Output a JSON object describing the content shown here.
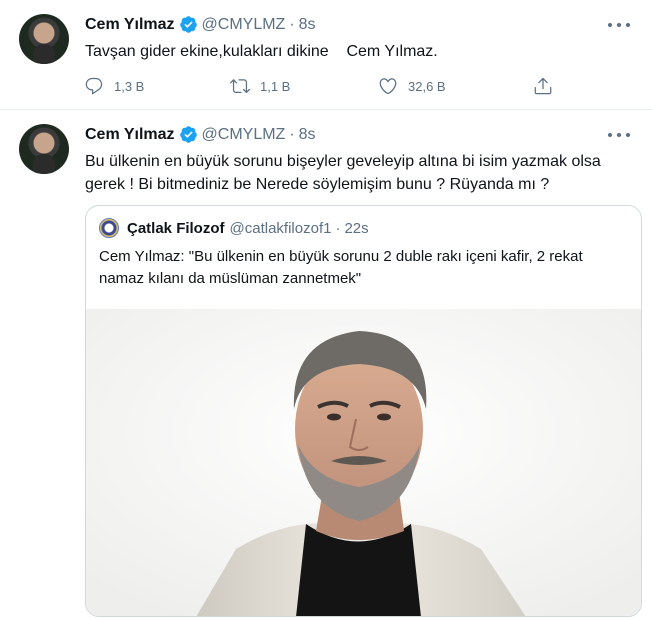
{
  "tweets": [
    {
      "author_name": "Cem Yılmaz",
      "handle": "@CMYLMZ",
      "separator": "·",
      "time": "8s",
      "text": "Tavşan gider ekine,kulakları dikine    Cem Yılmaz.",
      "stats": {
        "replies": "1,3 B",
        "retweets": "1,1 B",
        "likes": "32,6 B"
      }
    },
    {
      "author_name": "Cem Yılmaz",
      "handle": "@CMYLMZ",
      "separator": "·",
      "time": "8s",
      "text": "Bu ülkenin en büyük sorunu bişeyler geveleyip altına bi isim yazmak olsa gerek ! Bi bitmediniz be Nerede söylemişim bunu ? Rüyanda mı ?",
      "quoted": {
        "author_name": "Çatlak Filozof",
        "handle": "@catlakfilozof1",
        "separator": "·",
        "time": "22s",
        "text": "Cem Yılmaz: \"Bu ülkenin en büyük sorunu 2 duble rakı içeni kafir, 2 rekat namaz kılanı da müslüman zannetmek\""
      }
    }
  ],
  "colors": {
    "text": "#0f1419",
    "muted": "#5b7083",
    "verified": "#1da1f2",
    "divider": "#e6ecf0"
  },
  "icons": [
    "verified-badge-icon",
    "more-options-icon",
    "reply-icon",
    "retweet-icon",
    "like-icon",
    "share-icon"
  ]
}
